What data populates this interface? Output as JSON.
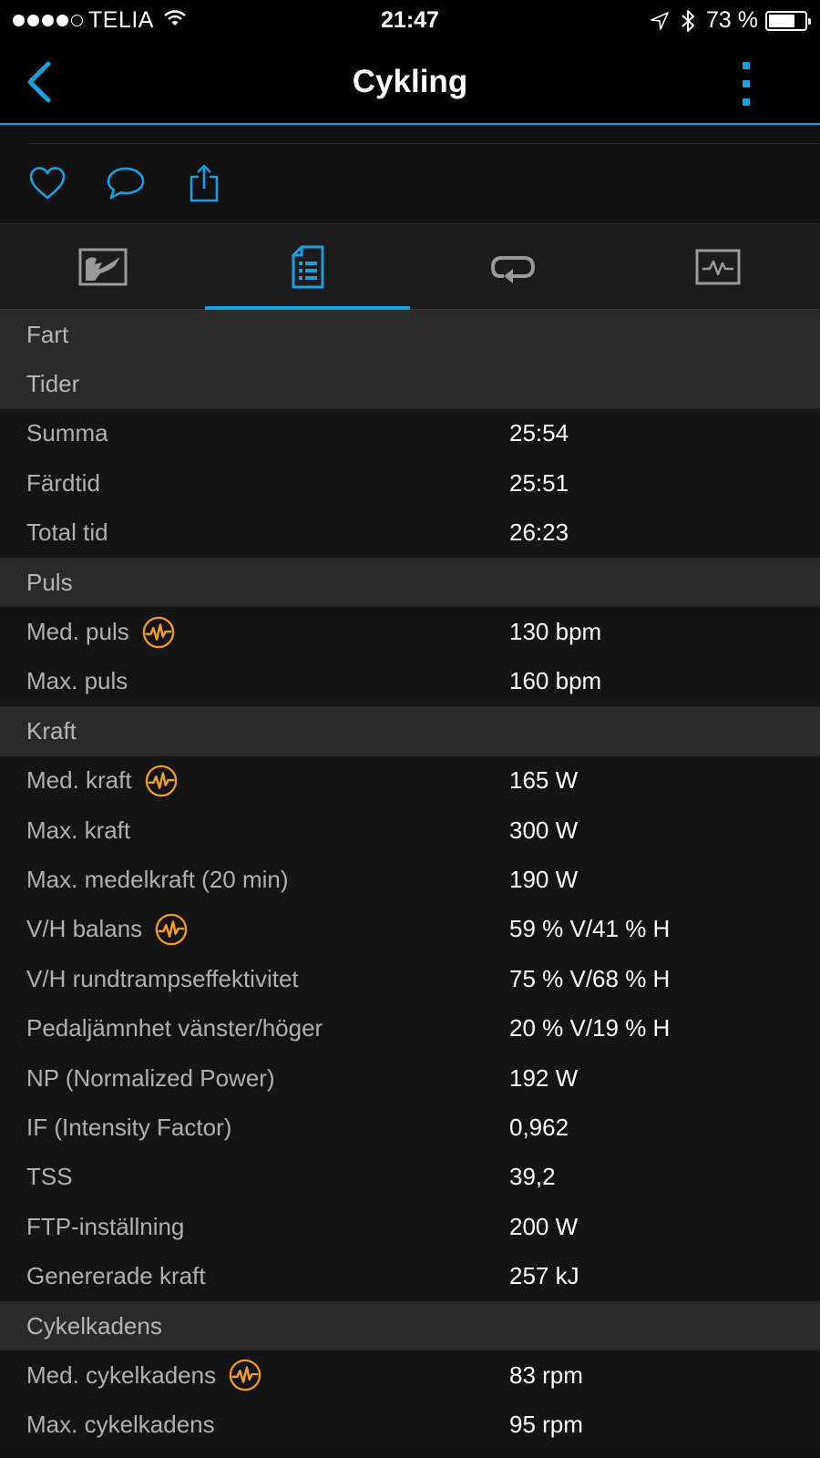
{
  "status_bar": {
    "carrier": "TELIA",
    "time": "21:47",
    "battery": "73 %",
    "battery_level": 0.73,
    "signal_dots_filled": 4,
    "signal_dots_total": 5
  },
  "nav": {
    "title": "Cykling",
    "back_icon": "chevron-left-icon",
    "more_icon": "more-vertical-icon"
  },
  "actions": [
    "heart-icon",
    "comment-icon",
    "share-icon"
  ],
  "tabs": [
    {
      "icon": "map-icon",
      "active": false
    },
    {
      "icon": "details-icon",
      "active": true
    },
    {
      "icon": "laps-icon",
      "active": false
    },
    {
      "icon": "charts-icon",
      "active": false
    }
  ],
  "colors": {
    "accent": "#1a9fe0",
    "badge": "#f0a020",
    "section_bg": "#2a2a2a",
    "row_bg": "#141414"
  },
  "sections": [
    {
      "title": "Fart",
      "rows": []
    },
    {
      "title": "Tider",
      "rows": [
        {
          "label": "Summa",
          "value": "25:54",
          "badge": false
        },
        {
          "label": "Färdtid",
          "value": "25:51",
          "badge": false
        },
        {
          "label": "Total tid",
          "value": "26:23",
          "badge": false
        }
      ]
    },
    {
      "title": "Puls",
      "rows": [
        {
          "label": "Med. puls",
          "value": "130 bpm",
          "badge": true
        },
        {
          "label": "Max. puls",
          "value": "160 bpm",
          "badge": false
        }
      ]
    },
    {
      "title": "Kraft",
      "rows": [
        {
          "label": "Med. kraft",
          "value": "165 W",
          "badge": true
        },
        {
          "label": "Max. kraft",
          "value": "300 W",
          "badge": false
        },
        {
          "label": "Max. medelkraft (20 min)",
          "value": "190 W",
          "badge": false
        },
        {
          "label": "V/H balans",
          "value": "59 % V/41 % H",
          "badge": true
        },
        {
          "label": "V/H rundtrampseffektivitet",
          "value": "75 % V/68 % H",
          "badge": false
        },
        {
          "label": "Pedaljämnhet vänster/höger",
          "value": "20 % V/19 % H",
          "badge": false
        },
        {
          "label": "NP (Normalized Power)",
          "value": "192 W",
          "badge": false
        },
        {
          "label": "IF (Intensity Factor)",
          "value": "0,962",
          "badge": false
        },
        {
          "label": "TSS",
          "value": "39,2",
          "badge": false
        },
        {
          "label": "FTP-inställning",
          "value": "200 W",
          "badge": false
        },
        {
          "label": "Genererade kraft",
          "value": "257 kJ",
          "badge": false
        }
      ]
    },
    {
      "title": "Cykelkadens",
      "rows": [
        {
          "label": "Med. cykelkadens",
          "value": "83 rpm",
          "badge": true
        },
        {
          "label": "Max. cykelkadens",
          "value": "95 rpm",
          "badge": false
        }
      ]
    }
  ]
}
